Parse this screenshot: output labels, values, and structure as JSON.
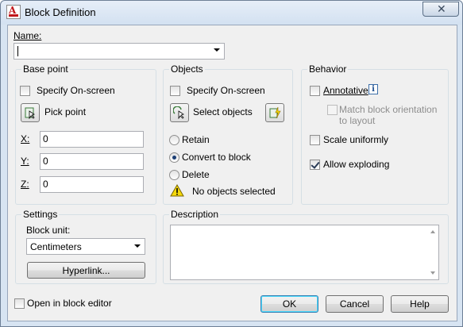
{
  "window": {
    "title": "Block Definition",
    "close_glyph": "✕"
  },
  "name": {
    "label": "Name:",
    "value": ""
  },
  "base_point": {
    "title": "Base point",
    "specify_label": "Specify On-screen",
    "specify_checked": false,
    "pick_label": "Pick point",
    "x_label": "X:",
    "x_value": "0",
    "y_label": "Y:",
    "y_value": "0",
    "z_label": "Z:",
    "z_value": "0"
  },
  "objects": {
    "title": "Objects",
    "specify_label": "Specify On-screen",
    "specify_checked": false,
    "select_label": "Select objects",
    "retain_label": "Retain",
    "convert_label": "Convert to block",
    "delete_label": "Delete",
    "selected_option": "convert",
    "status": "No objects selected"
  },
  "behavior": {
    "title": "Behavior",
    "annotative_label": "Annotative",
    "annotative_checked": false,
    "match_label_line1": "Match block orientation",
    "match_label_line2": "to layout",
    "scale_label": "Scale uniformly",
    "scale_checked": false,
    "explode_label": "Allow exploding",
    "explode_checked": true
  },
  "settings": {
    "title": "Settings",
    "unit_label": "Block unit:",
    "unit_value": "Centimeters",
    "hyperlink_label": "Hyperlink..."
  },
  "description": {
    "title": "Description",
    "value": ""
  },
  "footer": {
    "open_editor_label": "Open in block editor",
    "open_editor_checked": false,
    "ok_label": "OK",
    "cancel_label": "Cancel",
    "help_label": "Help"
  },
  "colors": {
    "accent": "#3c7fb1",
    "warning": "#f5d90a",
    "frame": "#d7e4f2"
  },
  "icons": [
    "autocad-app-icon",
    "close-icon",
    "pick-point-icon",
    "select-objects-icon",
    "quick-select-icon",
    "warning-icon",
    "info-icon",
    "dropdown-arrow-icon"
  ]
}
